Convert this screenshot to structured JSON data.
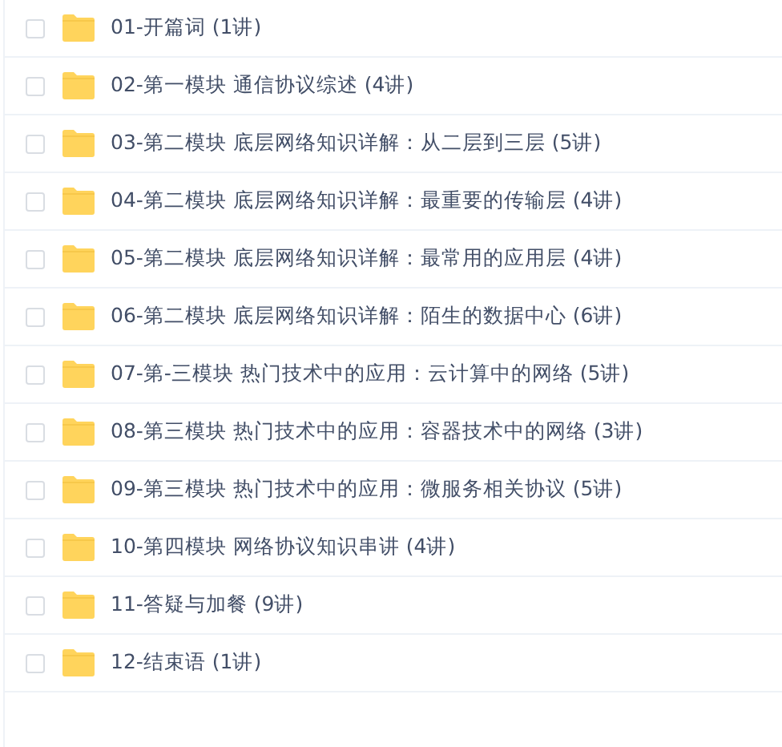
{
  "files": [
    {
      "name": "01-开篇词 (1讲)",
      "checked": false
    },
    {
      "name": "02-第一模块 通信协议综述 (4讲)",
      "checked": false
    },
    {
      "name": "03-第二模块 底层网络知识详解：从二层到三层 (5讲)",
      "checked": false
    },
    {
      "name": "04-第二模块 底层网络知识详解：最重要的传输层 (4讲)",
      "checked": false
    },
    {
      "name": "05-第二模块 底层网络知识详解：最常用的应用层 (4讲)",
      "checked": false
    },
    {
      "name": "06-第二模块 底层网络知识详解：陌生的数据中心 (6讲)",
      "checked": false
    },
    {
      "name": "07-第-三模块 热门技术中的应用：云计算中的网络 (5讲)",
      "checked": false
    },
    {
      "name": "08-第三模块 热门技术中的应用：容器技术中的网络 (3讲)",
      "checked": false
    },
    {
      "name": "09-第三模块 热门技术中的应用：微服务相关协议 (5讲)",
      "checked": false
    },
    {
      "name": "10-第四模块 网络协议知识串讲 (4讲)",
      "checked": false
    },
    {
      "name": "11-答疑与加餐 (9讲)",
      "checked": false
    },
    {
      "name": "12-结束语 (1讲)",
      "checked": false
    }
  ]
}
